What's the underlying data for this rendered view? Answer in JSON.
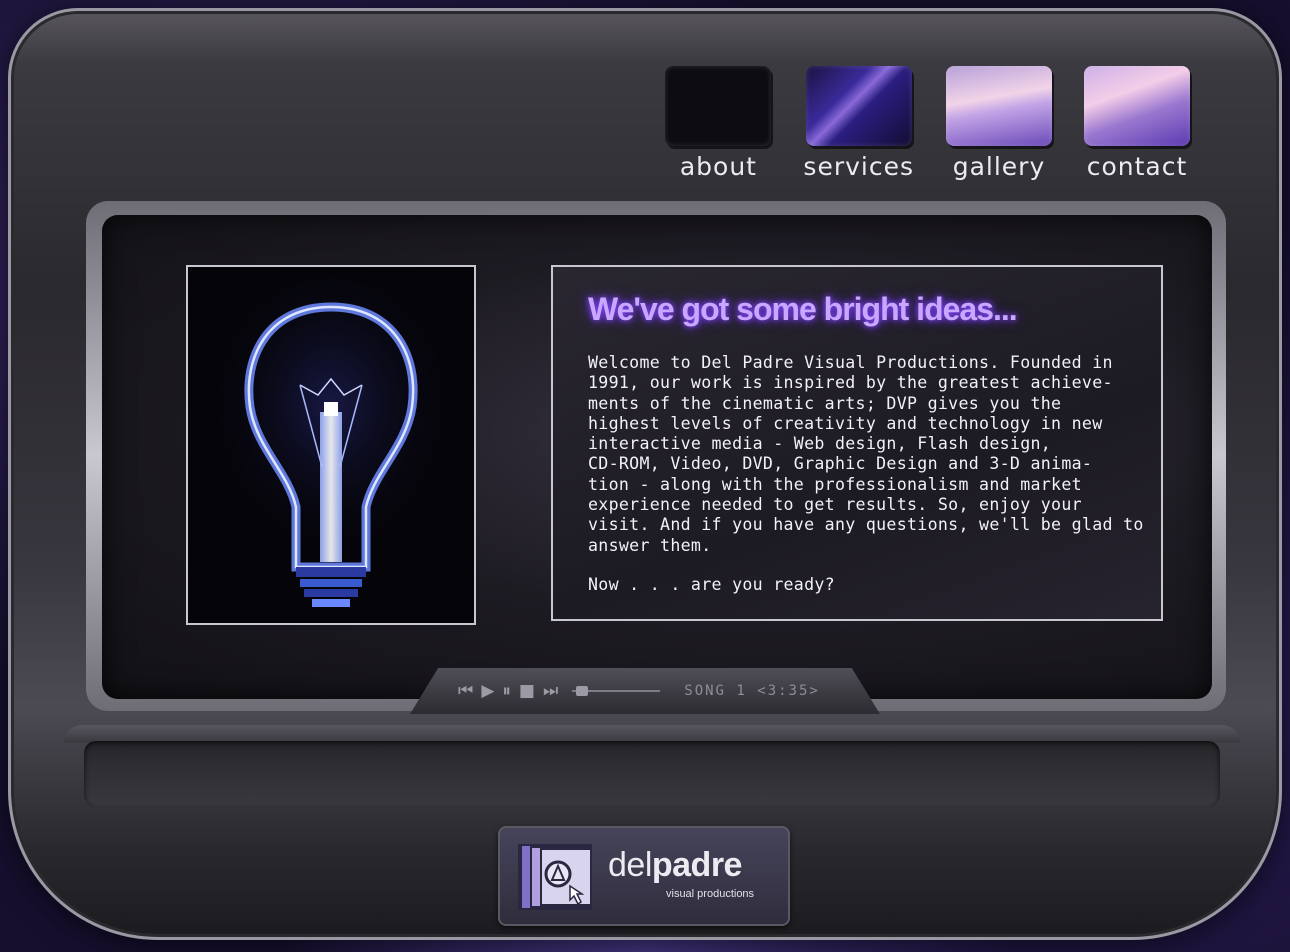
{
  "nav": {
    "items": [
      {
        "label": "about"
      },
      {
        "label": "services"
      },
      {
        "label": "gallery"
      },
      {
        "label": "contact"
      }
    ]
  },
  "content": {
    "headline": "We've got some bright ideas...",
    "body": "Welcome to Del Padre Visual Productions. Founded in\n1991, our work is inspired by the greatest achieve-\nments of the cinematic arts; DVP gives you the\nhighest levels of creativity and technology in new\ninteractive media - Web design, Flash design,\nCD-ROM, Video, DVD, Graphic Design and 3-D anima-\ntion - along with the professionalism and market\nexperience needed to get results. So, enjoy your\nvisit. And if you have any questions, we'll be glad to\nanswer them.",
    "closing": "Now . . . are you ready?"
  },
  "player": {
    "icons": {
      "prev": "skip-back-icon",
      "play": "play-icon",
      "pause": "pause-icon",
      "stop": "stop-icon",
      "next": "skip-forward-icon"
    },
    "song_label": "SONG 1 <3:35>",
    "position_fraction": 0.05
  },
  "logo": {
    "word_light": "del",
    "word_bold": "padre",
    "subtitle": "visual productions"
  },
  "colors": {
    "headline_glow": "#c9a6ff",
    "accent_purple": "#6a4ab8",
    "bulb_glow": "#4a6aff"
  }
}
